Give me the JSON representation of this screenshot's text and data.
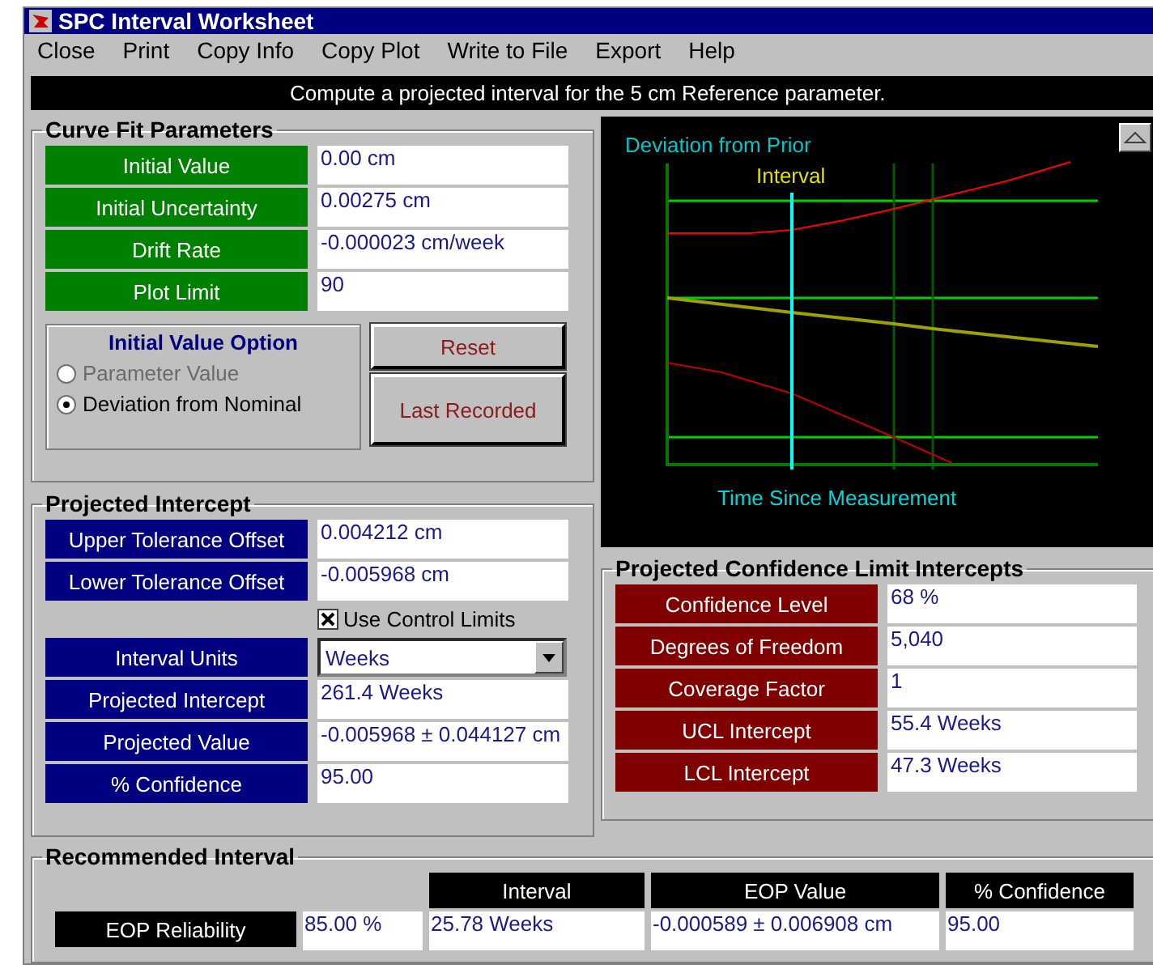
{
  "window": {
    "title": "SPC Interval Worksheet"
  },
  "menu": [
    "Close",
    "Print",
    "Copy Info",
    "Copy Plot",
    "Write to File",
    "Export",
    "Help"
  ],
  "banner": "Compute a projected interval for the 5 cm Reference parameter.",
  "curve_fit": {
    "title": "Curve Fit Parameters",
    "fields": [
      {
        "label": "Initial Value",
        "value": "0.00 cm"
      },
      {
        "label": "Initial Uncertainty",
        "value": "0.00275 cm"
      },
      {
        "label": "Drift Rate",
        "value": "-0.000023 cm/week"
      },
      {
        "label": "Plot Limit",
        "value": "90"
      }
    ],
    "option_group": {
      "title": "Initial Value Option",
      "options": [
        {
          "label": "Parameter Value",
          "selected": false,
          "disabled": true
        },
        {
          "label": "Deviation from Nominal",
          "selected": true,
          "disabled": false
        }
      ]
    },
    "buttons": [
      "Reset",
      "Last Recorded"
    ]
  },
  "projected_intercept": {
    "title": "Projected Intercept",
    "tolerances": [
      {
        "label": "Upper Tolerance Offset",
        "value": "0.004212 cm"
      },
      {
        "label": "Lower Tolerance Offset",
        "value": "-0.005968 cm"
      }
    ],
    "checkbox": {
      "label": "Use Control Limits",
      "checked": true
    },
    "interval_units": {
      "label": "Interval Units",
      "value": "Weeks"
    },
    "results": [
      {
        "label": "Projected Intercept",
        "value": "261.4 Weeks"
      },
      {
        "label": "Projected Value",
        "value": "-0.005968 ± 0.044127 cm"
      },
      {
        "label": "% Confidence",
        "value": "95.00"
      }
    ]
  },
  "plot": {
    "title": "Deviation from Prior",
    "marker_label": "Interval",
    "xlabel": "Time Since Measurement"
  },
  "confidence_limits": {
    "title": "Projected Confidence Limit Intercepts",
    "fields": [
      {
        "label": "Confidence Level",
        "value": "68 %"
      },
      {
        "label": "Degrees of Freedom",
        "value": "5,040"
      },
      {
        "label": "Coverage Factor",
        "value": "1"
      },
      {
        "label": "UCL Intercept",
        "value": "55.4 Weeks"
      },
      {
        "label": "LCL Intercept",
        "value": "47.3 Weeks"
      }
    ]
  },
  "recommended": {
    "title": "Recommended Interval",
    "columns": [
      "Interval",
      "EOP Value",
      "% Confidence"
    ],
    "row_label": "EOP Reliability",
    "reliability": "85.00 %",
    "values": [
      "25.78 Weeks",
      "-0.000589 ± 0.006908 cm",
      "95.00"
    ]
  }
}
